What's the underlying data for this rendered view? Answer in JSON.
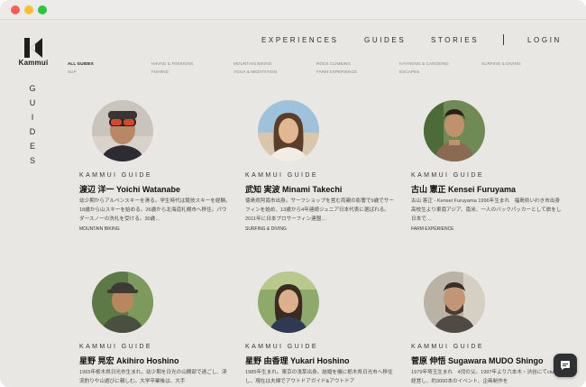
{
  "window": {
    "controls": [
      "close",
      "minimize",
      "zoom"
    ]
  },
  "brand": {
    "name": "Kammui",
    "logo_icon": "k-mountain-logo"
  },
  "nav": {
    "items": [
      {
        "label": "EXPERIENCES"
      },
      {
        "label": "GUIDES"
      },
      {
        "label": "STORIES"
      },
      {
        "label": "LOGIN"
      }
    ]
  },
  "filters": {
    "row1": [
      "ALL GUIDES",
      "HIKING & TREKKING",
      "MOUNTAIN BIKING",
      "ROCK CLIMBING",
      "KAYAKING & CANOEING",
      "SURFING & DIVING"
    ],
    "row2": [
      "SUP",
      "FISHING",
      "YOGA & MEDITATION",
      "FARM EXPERIENCE",
      "ESCAPES"
    ],
    "active": "ALL GUIDES"
  },
  "page": {
    "vertical_title": "GUIDES"
  },
  "guides": [
    {
      "kicker": "KAMMUI GUIDE",
      "name": "渡辺 洋一 Yoichi Watanabe",
      "desc": "幼少期からアルペンスキーを滑る。学生時代は競技スキーを経験。18歳から山スキーを始める。26歳から北海道札幌市へ移住。パウダースノーの洗礼を受ける。30歳…",
      "tag": "MOUNTAIN BIKING"
    },
    {
      "kicker": "KAMMUI GUIDE",
      "name": "武知 実波 Minami Takechi",
      "desc": "徳島県阿南市出身。サーフショップを営む両親の影響で9歳でサーフィンを始め、13歳から4年連続ジュニア日本代表に選ばれる。2011年に日本プロサーフィン連盟…",
      "tag": "SURFING & DIVING"
    },
    {
      "kicker": "KAMMUI GUIDE",
      "name": "古山 憲正 Kensei Furuyama",
      "desc": "古山 憲正 - Kensei Furuyama 1996年生まれ　福島県いわき市出身 高校生より東南アジア、南米、一人のバックパッカーとして旅をし日本で…",
      "tag": "FARM EXPERIENCE"
    },
    {
      "kicker": "KAMMUI GUIDE",
      "name": "星野 晃宏 Akihiro Hoshino",
      "desc": "1965年栃木県日光市生まれ。幼少期を日光の山間部で過ごし、渓流釣りや山遊びに親しむ。大学卒業後は、大手",
      "tag": ""
    },
    {
      "kicker": "KAMMUI GUIDE",
      "name": "星野 由香理 Yukari Hoshino",
      "desc": "1985年生まれ。東京の浅草出身。結婚を機に栃木県日光市へ移住し、現在は夫婦でアウトドアガイド&アウトドア",
      "tag": ""
    },
    {
      "kicker": "KAMMUI GUIDE",
      "name": "菅原 伸悟 Sugawara MUDO Shingo",
      "desc": "1979年埼玉生まれ　4児の父。1997年より六本木・渋谷にてclubを経営し、約3000本のイベント、企画制作を",
      "tag": ""
    }
  ],
  "chat": {
    "icon": "chat-bubble-icon"
  }
}
